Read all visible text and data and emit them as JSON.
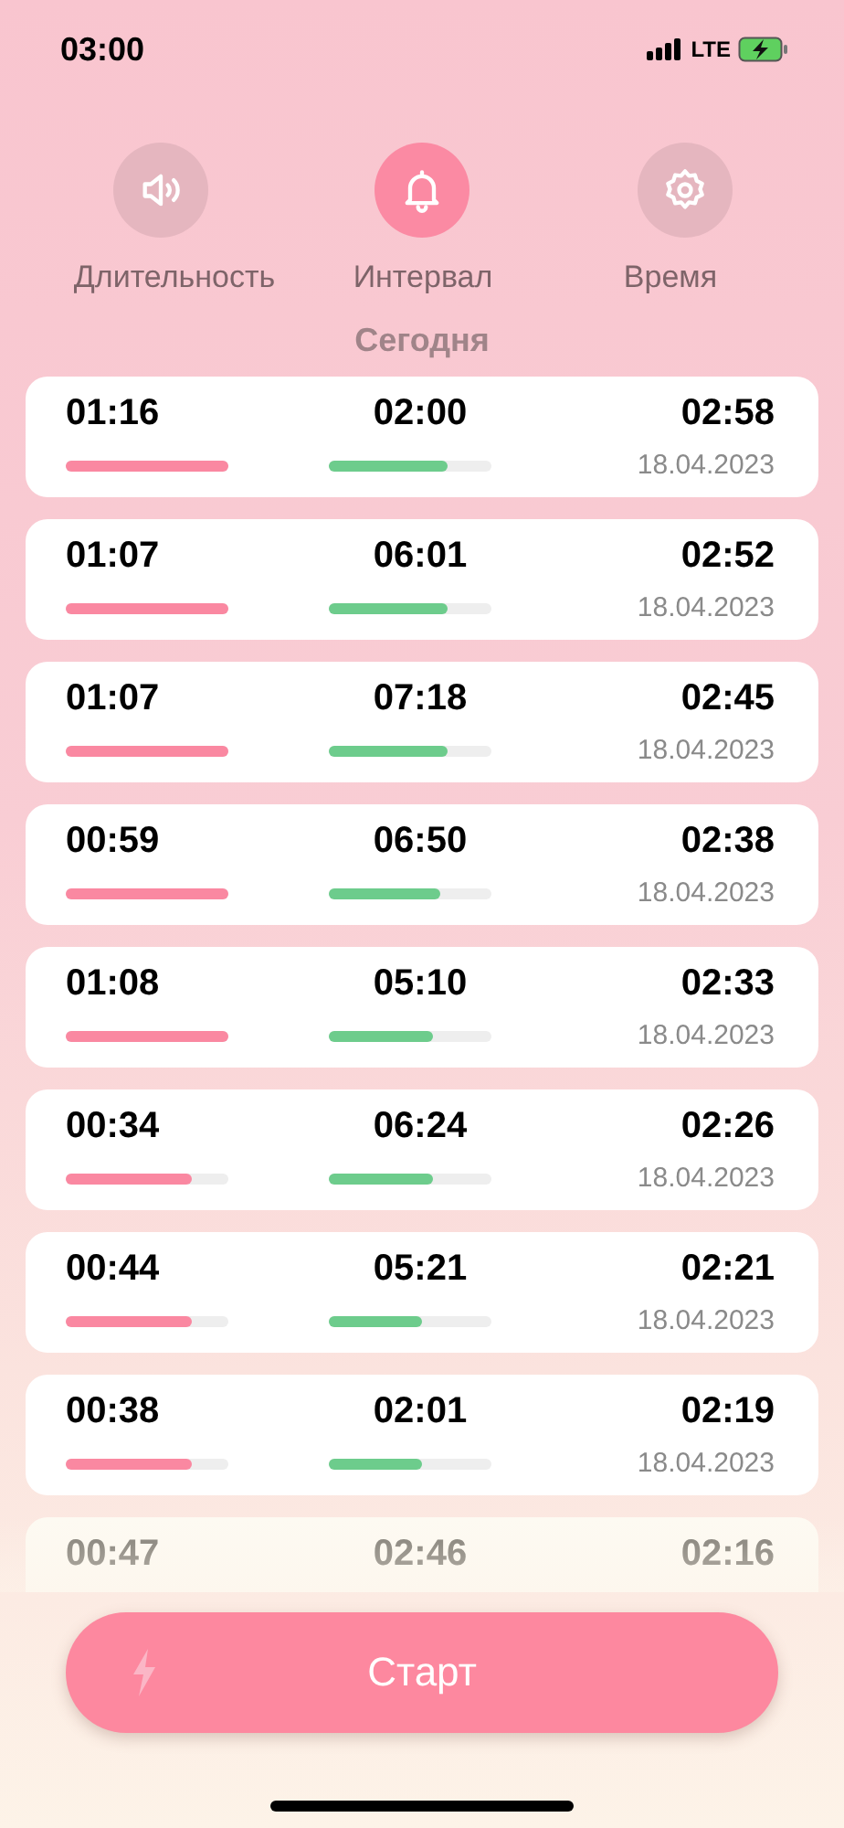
{
  "status_bar": {
    "time": "03:00",
    "network": "LTE"
  },
  "tabs": [
    {
      "label": "Длительность",
      "selected": false
    },
    {
      "label": "Интервал",
      "selected": true
    },
    {
      "label": "Время",
      "selected": false
    }
  ],
  "section_title": "Сегодня",
  "rows": [
    {
      "duration": "01:16",
      "interval": "02:00",
      "time": "02:58",
      "date": "18.04.2023",
      "duration_bar": {
        "level": 1.0
      },
      "interval_bar": {
        "level": 0.73
      }
    },
    {
      "duration": "01:07",
      "interval": "06:01",
      "time": "02:52",
      "date": "18.04.2023",
      "duration_bar": {
        "level": 1.0
      },
      "interval_bar": {
        "level": 0.73
      }
    },
    {
      "duration": "01:07",
      "interval": "07:18",
      "time": "02:45",
      "date": "18.04.2023",
      "duration_bar": {
        "level": 1.0
      },
      "interval_bar": {
        "level": 0.73
      }
    },
    {
      "duration": "00:59",
      "interval": "06:50",
      "time": "02:38",
      "date": "18.04.2023",
      "duration_bar": {
        "level": 1.0
      },
      "interval_bar": {
        "level": 0.69
      }
    },
    {
      "duration": "01:08",
      "interval": "05:10",
      "time": "02:33",
      "date": "18.04.2023",
      "duration_bar": {
        "level": 1.0
      },
      "interval_bar": {
        "level": 0.64
      }
    },
    {
      "duration": "00:34",
      "interval": "06:24",
      "time": "02:26",
      "date": "18.04.2023",
      "duration_bar": {
        "level": 0.78
      },
      "interval_bar": {
        "level": 0.64
      }
    },
    {
      "duration": "00:44",
      "interval": "05:21",
      "time": "02:21",
      "date": "18.04.2023",
      "duration_bar": {
        "level": 0.78
      },
      "interval_bar": {
        "level": 0.57
      }
    },
    {
      "duration": "00:38",
      "interval": "02:01",
      "time": "02:19",
      "date": "18.04.2023",
      "duration_bar": {
        "level": 0.78
      },
      "interval_bar": {
        "level": 0.57
      }
    },
    {
      "duration": "00:47",
      "interval": "02:46",
      "time": "02:16"
    }
  ],
  "start_button": {
    "label": "Старт"
  }
}
